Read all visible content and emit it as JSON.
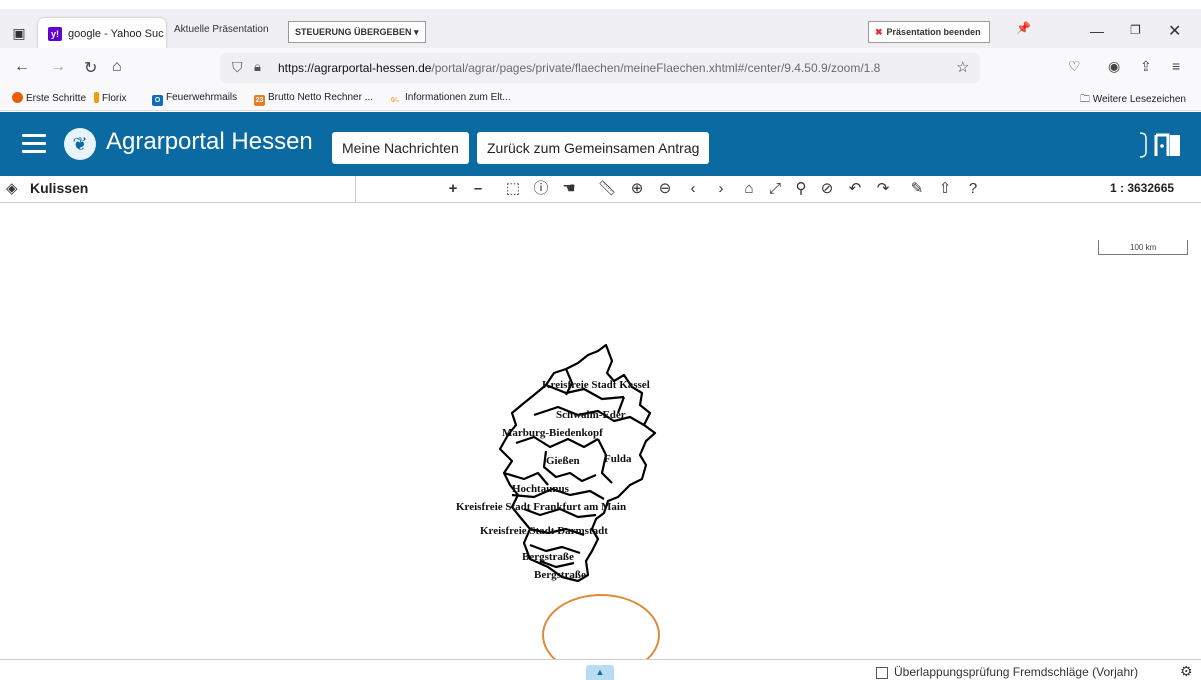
{
  "browser": {
    "tab_title": "google - Yahoo Such",
    "tab_icon": "y!",
    "url_host": "https://agrarportal-hessen.de",
    "url_path": "/portal/agrar/pages/private/flaechen/meineFlaechen.xhtml#/center/9.4.50.9/zoom/1.8",
    "bookmarks": [
      {
        "label": "Erste Schritte",
        "icon": "",
        "color": "#e66000"
      },
      {
        "label": "Florix",
        "icon": "",
        "color": "#f39c12"
      },
      {
        "label": "Feuerwehrmails",
        "icon": "O",
        "color": "#0f6cbd"
      },
      {
        "label": "Brutto Netto Rechner ...",
        "icon": "23",
        "color": "#e67e22"
      },
      {
        "label": "Informationen zum Elt...",
        "icon": "",
        "color": "#f5b041"
      }
    ],
    "other_bookmarks": "Weitere Lesezeichen"
  },
  "presentation": {
    "label": "Aktuelle Präsentation",
    "handover": "STEUERUNG ÜBERGEBEN",
    "end": "Präsentation beenden"
  },
  "app": {
    "title": "Agrarportal Hessen",
    "messages_button": "Meine Nachrichten",
    "back_button": "Zurück zum Gemeinsamen Antrag",
    "brand_color": "#0a6aa1"
  },
  "toolbar": {
    "layers_label": "Kulissen",
    "zoom_in": "+",
    "zoom_out": "–",
    "scale": "1 : 3632665"
  },
  "map": {
    "scalebar_label": "100 km",
    "districts": [
      {
        "name": "Kreisfreie Stadt Kassel"
      },
      {
        "name": "Schwalm-Eder"
      },
      {
        "name": "Marburg-Biedenkopf"
      },
      {
        "name": "Gießen"
      },
      {
        "name": "Fulda"
      },
      {
        "name": "Hochtaunus"
      },
      {
        "name": "Kreisfreie Stadt Frankfurt am Main"
      },
      {
        "name": "Kreisfreie Stadt Darmstadt"
      },
      {
        "name": "Bergstraße"
      },
      {
        "name": "Bergstraße"
      }
    ]
  },
  "footer": {
    "overlap_label": "Überlappungsprüfung Fremdschläge (Vorjahr)"
  }
}
